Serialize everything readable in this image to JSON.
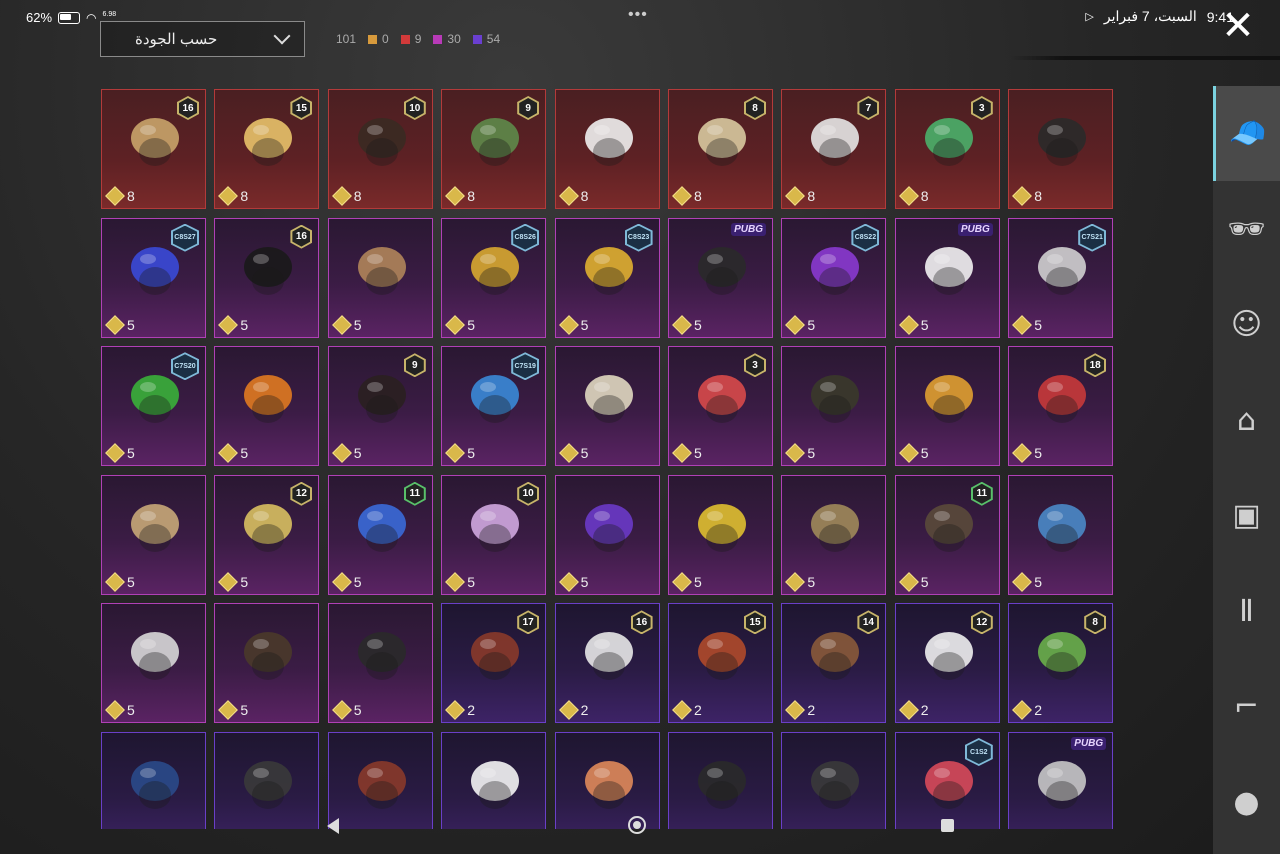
{
  "status_bar": {
    "battery": "62%",
    "net_speed": "6.98",
    "date": "السبت، 7 فبراير",
    "time": "9:41"
  },
  "sort": {
    "label": "حسب الجودة"
  },
  "counts": [
    {
      "value": "101",
      "color": ""
    },
    {
      "value": "0",
      "color": "#d79a3c"
    },
    {
      "value": "9",
      "color": "#d23a3a"
    },
    {
      "value": "30",
      "color": "#b83ab8"
    },
    {
      "value": "54",
      "color": "#6a3fd0"
    }
  ],
  "items": [
    {
      "rarity": "red",
      "badge": "16",
      "badge_type": "level",
      "cost": "8",
      "icon": "goggle-cap-hair-icon"
    },
    {
      "rarity": "red",
      "badge": "15",
      "badge_type": "level",
      "cost": "8",
      "icon": "blonde-hair-bow-icon"
    },
    {
      "rarity": "red",
      "badge": "10",
      "badge_type": "level",
      "cost": "8",
      "icon": "dark-hair-icon"
    },
    {
      "rarity": "red",
      "badge": "9",
      "badge_type": "level",
      "cost": "8",
      "icon": "zombie-mask-icon"
    },
    {
      "rarity": "red",
      "badge": "",
      "badge_type": "",
      "cost": "8",
      "icon": "white-cowboy-hat-icon"
    },
    {
      "rarity": "red",
      "badge": "8",
      "badge_type": "level",
      "cost": "8",
      "icon": "blonde-bob-hair-icon"
    },
    {
      "rarity": "red",
      "badge": "7",
      "badge_type": "level",
      "cost": "8",
      "icon": "white-hair-icon"
    },
    {
      "rarity": "red",
      "badge": "3",
      "badge_type": "level",
      "cost": "8",
      "icon": "joker-mask-icon"
    },
    {
      "rarity": "red",
      "badge": "",
      "badge_type": "",
      "cost": "8",
      "icon": "helmet-mask-icon"
    },
    {
      "rarity": "purple",
      "badge": "C8S27",
      "badge_type": "season",
      "cost": "5",
      "icon": "bunny-headphones-icon"
    },
    {
      "rarity": "purple",
      "badge": "16",
      "badge_type": "level",
      "cost": "5",
      "icon": "black-hood-icon"
    },
    {
      "rarity": "purple",
      "badge": "",
      "badge_type": "",
      "cost": "5",
      "icon": "antler-hair-icon"
    },
    {
      "rarity": "purple",
      "badge": "C8S26",
      "badge_type": "season",
      "cost": "5",
      "icon": "bee-mask-icon"
    },
    {
      "rarity": "purple",
      "badge": "C8S23",
      "badge_type": "season",
      "cost": "5",
      "icon": "cat-headphones-icon"
    },
    {
      "rarity": "purple",
      "badge": "PUBG",
      "badge_type": "brand",
      "cost": "5",
      "icon": "cap-goggles-icon"
    },
    {
      "rarity": "purple",
      "badge": "C8S22",
      "badge_type": "season",
      "cost": "5",
      "icon": "purple-hair-icon"
    },
    {
      "rarity": "purple",
      "badge": "PUBG",
      "badge_type": "brand",
      "cost": "5",
      "icon": "panda-mask-icon"
    },
    {
      "rarity": "purple",
      "badge": "C7S21",
      "badge_type": "season",
      "cost": "5",
      "icon": "silver-hair-icon"
    },
    {
      "rarity": "purple",
      "badge": "C7S20",
      "badge_type": "season",
      "cost": "5",
      "icon": "green-pigtails-icon"
    },
    {
      "rarity": "purple",
      "badge": "",
      "badge_type": "",
      "cost": "5",
      "icon": "pumpkin-mask-icon"
    },
    {
      "rarity": "purple",
      "badge": "9",
      "badge_type": "level",
      "cost": "5",
      "icon": "long-dark-hair-icon"
    },
    {
      "rarity": "purple",
      "badge": "C7S19",
      "badge_type": "season",
      "cost": "5",
      "icon": "feather-headdress-icon"
    },
    {
      "rarity": "purple",
      "badge": "",
      "badge_type": "",
      "cost": "5",
      "icon": "braided-hair-icon"
    },
    {
      "rarity": "purple",
      "badge": "3",
      "badge_type": "level",
      "cost": "5",
      "icon": "jester-hat-icon"
    },
    {
      "rarity": "purple",
      "badge": "",
      "badge_type": "",
      "cost": "5",
      "icon": "witch-hat-icon"
    },
    {
      "rarity": "purple",
      "badge": "",
      "badge_type": "",
      "cost": "5",
      "icon": "potato-mask-icon"
    },
    {
      "rarity": "purple",
      "badge": "18",
      "badge_type": "level",
      "cost": "5",
      "icon": "top-hat-icon"
    },
    {
      "rarity": "purple",
      "badge": "",
      "badge_type": "",
      "cost": "5",
      "icon": "straw-hat-icon"
    },
    {
      "rarity": "purple",
      "badge": "12",
      "badge_type": "level",
      "cost": "5",
      "icon": "cylinder-helmet-icon"
    },
    {
      "rarity": "purple",
      "badge": "11",
      "badge_type": "level-green",
      "cost": "5",
      "icon": "blue-cap-hair-icon"
    },
    {
      "rarity": "purple",
      "badge": "10",
      "badge_type": "level",
      "cost": "5",
      "icon": "pink-helmet-icon"
    },
    {
      "rarity": "purple",
      "badge": "",
      "badge_type": "",
      "cost": "5",
      "icon": "mecha-helmet-icon"
    },
    {
      "rarity": "purple",
      "badge": "",
      "badge_type": "",
      "cost": "5",
      "icon": "gold-crown-mask-icon"
    },
    {
      "rarity": "purple",
      "badge": "",
      "badge_type": "",
      "cost": "5",
      "icon": "brass-helmet-icon"
    },
    {
      "rarity": "purple",
      "badge": "11",
      "badge_type": "level-green",
      "cost": "5",
      "icon": "camera-helmet-icon"
    },
    {
      "rarity": "purple",
      "badge": "",
      "badge_type": "",
      "cost": "5",
      "icon": "tv-head-icon"
    },
    {
      "rarity": "purple",
      "badge": "",
      "badge_type": "",
      "cost": "5",
      "icon": "white-shaggy-hair-icon"
    },
    {
      "rarity": "purple",
      "badge": "",
      "badge_type": "",
      "cost": "5",
      "icon": "antler-headband-icon"
    },
    {
      "rarity": "purple",
      "badge": "",
      "badge_type": "",
      "cost": "5",
      "icon": "small-ears-icon"
    },
    {
      "rarity": "violet",
      "badge": "17",
      "badge_type": "level",
      "cost": "2",
      "icon": "red-hair-crown-icon"
    },
    {
      "rarity": "violet",
      "badge": "16",
      "badge_type": "level",
      "cost": "2",
      "icon": "beanie-goggles-icon"
    },
    {
      "rarity": "violet",
      "badge": "15",
      "badge_type": "level",
      "cost": "2",
      "icon": "pumpkin-beanie-icon"
    },
    {
      "rarity": "violet",
      "badge": "14",
      "badge_type": "level",
      "cost": "2",
      "icon": "cat-ear-cap-icon"
    },
    {
      "rarity": "violet",
      "badge": "12",
      "badge_type": "level",
      "cost": "2",
      "icon": "bunny-helmet-icon"
    },
    {
      "rarity": "violet",
      "badge": "8",
      "badge_type": "level",
      "cost": "2",
      "icon": "green-skull-hair-icon"
    },
    {
      "rarity": "violet",
      "badge": "",
      "badge_type": "",
      "cost": "",
      "icon": "baseball-cap-icon"
    },
    {
      "rarity": "violet",
      "badge": "",
      "badge_type": "",
      "cost": "",
      "icon": "visor-helmet-icon"
    },
    {
      "rarity": "violet",
      "badge": "",
      "badge_type": "",
      "cost": "",
      "icon": "goggles-red-hair-icon"
    },
    {
      "rarity": "violet",
      "badge": "",
      "badge_type": "",
      "cost": "",
      "icon": "sun-hat-icon"
    },
    {
      "rarity": "violet",
      "badge": "",
      "badge_type": "",
      "cost": "",
      "icon": "fox-ears-icon"
    },
    {
      "rarity": "violet",
      "badge": "",
      "badge_type": "",
      "cost": "",
      "icon": "black-cap-icon"
    },
    {
      "rarity": "violet",
      "badge": "",
      "badge_type": "",
      "cost": "",
      "icon": "bucket-hat-icon"
    },
    {
      "rarity": "violet",
      "badge": "C1S2",
      "badge_type": "season",
      "cost": "",
      "icon": "striped-beanie-icon"
    },
    {
      "rarity": "violet",
      "badge": "PUBG",
      "badge_type": "brand",
      "cost": "",
      "icon": "grey-bob-hair-icon"
    }
  ],
  "sidebar": [
    {
      "name": "headwear-tab",
      "icon": "cap-icon",
      "active": true
    },
    {
      "name": "eyewear-tab",
      "icon": "glasses-icon",
      "active": false
    },
    {
      "name": "mask-tab",
      "icon": "face-mask-icon",
      "active": false
    },
    {
      "name": "top-tab",
      "icon": "jacket-icon",
      "active": false
    },
    {
      "name": "backpack-tab",
      "icon": "backpack-icon",
      "active": false
    },
    {
      "name": "pants-tab",
      "icon": "pants-icon",
      "active": false
    },
    {
      "name": "shoes-tab",
      "icon": "boots-icon",
      "active": false
    },
    {
      "name": "accessory-tab",
      "icon": "pendant-icon",
      "active": false
    }
  ],
  "item_colors": [
    "#c9a46a",
    "#e8c26a",
    "#3a2a22",
    "#5e8a4a",
    "#f0f0f0",
    "#d8c9a0",
    "#e6e6e6",
    "#4ab06a",
    "#2a2a2a",
    "#3a4ad8",
    "#1a1a1a",
    "#b0855a",
    "#d8a830",
    "#e0b030",
    "#2a2a2a",
    "#8a3ad0",
    "#f2f2f2",
    "#d0d0d0",
    "#3ab03a",
    "#e07a20",
    "#2a2020",
    "#3a8ad8",
    "#e0d8c0",
    "#d84a4a",
    "#3a3a2a",
    "#e0a030",
    "#c83a3a",
    "#c8a878",
    "#d8c060",
    "#3a6ad8",
    "#d0a8e0",
    "#6a3ac8",
    "#e0c030",
    "#a08a5a",
    "#5a4a3a",
    "#4a8ac8",
    "#d8d8d8",
    "#4a3a2a",
    "#2a2a2a",
    "#8a3a2a",
    "#e8e8e8",
    "#b04a2a",
    "#8a5a3a",
    "#f0f0f0",
    "#6ab04a",
    "#2a4a8a",
    "#3a3a3a",
    "#8a3a2a",
    "#f4f4f4",
    "#e08a5a",
    "#2a2a2a",
    "#3a3a3a",
    "#d84a5a",
    "#c8c8c8"
  ]
}
